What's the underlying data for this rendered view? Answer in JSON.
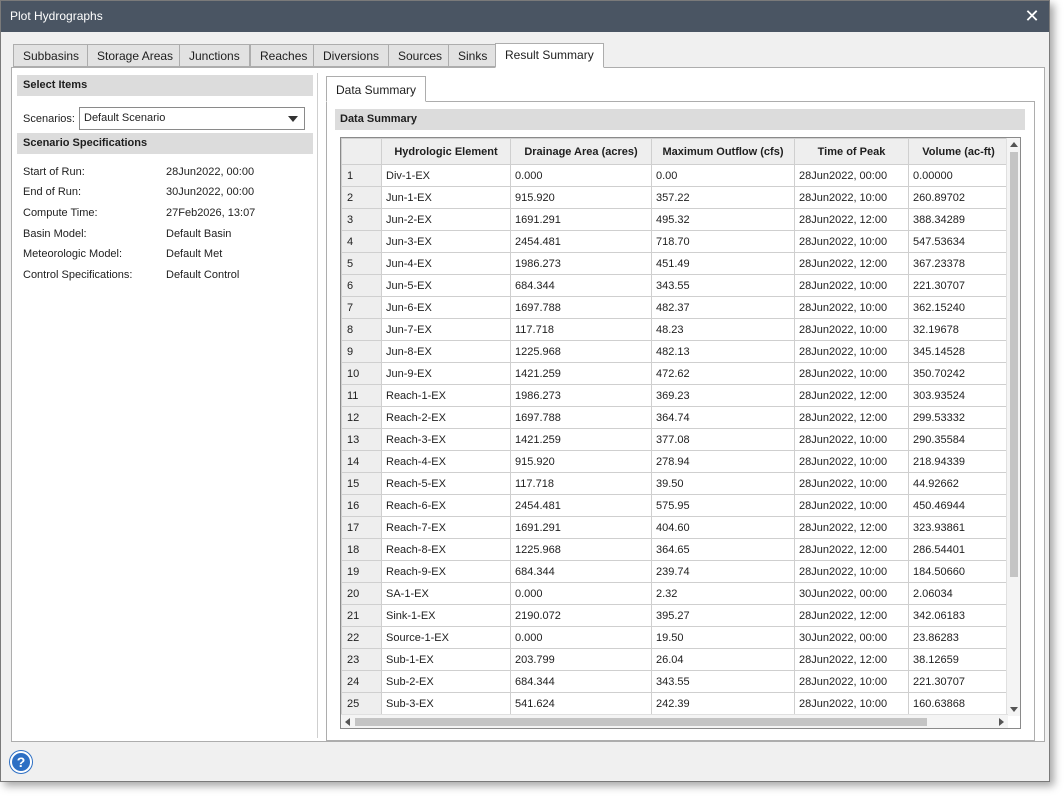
{
  "window": {
    "title": "Plot Hydrographs",
    "close_glyph": "✕"
  },
  "tabs": [
    "Subbasins",
    "Storage Areas",
    "Junctions",
    "Reaches",
    "Diversions",
    "Sources",
    "Sinks",
    "Result Summary"
  ],
  "active_tab": "Result Summary",
  "left": {
    "select_items_header": "Select Items",
    "scenarios_label": "Scenarios:",
    "scenario_value": "Default Scenario",
    "scenario_specs_header": "Scenario Specifications",
    "specs": [
      {
        "label": "Start of Run:",
        "value": "28Jun2022, 00:00"
      },
      {
        "label": "End of Run:",
        "value": "30Jun2022, 00:00"
      },
      {
        "label": "Compute Time:",
        "value": "27Feb2026, 13:07"
      },
      {
        "label": "Basin Model:",
        "value": "Default Basin"
      },
      {
        "label": "Meteorologic Model:",
        "value": "Default Met"
      },
      {
        "label": "Control Specifications:",
        "value": "Default Control"
      }
    ]
  },
  "right": {
    "subtab_label": "Data Summary",
    "panel_header": "Data Summary",
    "columns": [
      "Hydrologic Element",
      "Drainage Area (acres)",
      "Maximum Outflow (cfs)",
      "Time of Peak",
      "Volume (ac-ft)"
    ],
    "rows": [
      [
        "1",
        "Div-1-EX",
        "0.000",
        "0.00",
        "28Jun2022, 00:00",
        "0.00000"
      ],
      [
        "2",
        "Jun-1-EX",
        "915.920",
        "357.22",
        "28Jun2022, 10:00",
        "260.89702"
      ],
      [
        "3",
        "Jun-2-EX",
        "1691.291",
        "495.32",
        "28Jun2022, 12:00",
        "388.34289"
      ],
      [
        "4",
        "Jun-3-EX",
        "2454.481",
        "718.70",
        "28Jun2022, 10:00",
        "547.53634"
      ],
      [
        "5",
        "Jun-4-EX",
        "1986.273",
        "451.49",
        "28Jun2022, 12:00",
        "367.23378"
      ],
      [
        "6",
        "Jun-5-EX",
        "684.344",
        "343.55",
        "28Jun2022, 10:00",
        "221.30707"
      ],
      [
        "7",
        "Jun-6-EX",
        "1697.788",
        "482.37",
        "28Jun2022, 10:00",
        "362.15240"
      ],
      [
        "8",
        "Jun-7-EX",
        "117.718",
        "48.23",
        "28Jun2022, 10:00",
        "32.19678"
      ],
      [
        "9",
        "Jun-8-EX",
        "1225.968",
        "482.13",
        "28Jun2022, 10:00",
        "345.14528"
      ],
      [
        "10",
        "Jun-9-EX",
        "1421.259",
        "472.62",
        "28Jun2022, 10:00",
        "350.70242"
      ],
      [
        "11",
        "Reach-1-EX",
        "1986.273",
        "369.23",
        "28Jun2022, 12:00",
        "303.93524"
      ],
      [
        "12",
        "Reach-2-EX",
        "1697.788",
        "364.74",
        "28Jun2022, 12:00",
        "299.53332"
      ],
      [
        "13",
        "Reach-3-EX",
        "1421.259",
        "377.08",
        "28Jun2022, 10:00",
        "290.35584"
      ],
      [
        "14",
        "Reach-4-EX",
        "915.920",
        "278.94",
        "28Jun2022, 10:00",
        "218.94339"
      ],
      [
        "15",
        "Reach-5-EX",
        "117.718",
        "39.50",
        "28Jun2022, 10:00",
        "44.92662"
      ],
      [
        "16",
        "Reach-6-EX",
        "2454.481",
        "575.95",
        "28Jun2022, 10:00",
        "450.46944"
      ],
      [
        "17",
        "Reach-7-EX",
        "1691.291",
        "404.60",
        "28Jun2022, 12:00",
        "323.93861"
      ],
      [
        "18",
        "Reach-8-EX",
        "1225.968",
        "364.65",
        "28Jun2022, 12:00",
        "286.54401"
      ],
      [
        "19",
        "Reach-9-EX",
        "684.344",
        "239.74",
        "28Jun2022, 10:00",
        "184.50660"
      ],
      [
        "20",
        "SA-1-EX",
        "0.000",
        "2.32",
        "30Jun2022, 00:00",
        "2.06034"
      ],
      [
        "21",
        "Sink-1-EX",
        "2190.072",
        "395.27",
        "28Jun2022, 12:00",
        "342.06183"
      ],
      [
        "22",
        "Source-1-EX",
        "0.000",
        "19.50",
        "30Jun2022, 00:00",
        "23.86283"
      ],
      [
        "23",
        "Sub-1-EX",
        "203.799",
        "26.04",
        "28Jun2022, 12:00",
        "38.12659"
      ],
      [
        "24",
        "Sub-2-EX",
        "684.344",
        "343.55",
        "28Jun2022, 10:00",
        "221.30707"
      ],
      [
        "25",
        "Sub-3-EX",
        "541.624",
        "242.39",
        "28Jun2022, 10:00",
        "160.63868"
      ]
    ]
  },
  "help_glyph": "?"
}
